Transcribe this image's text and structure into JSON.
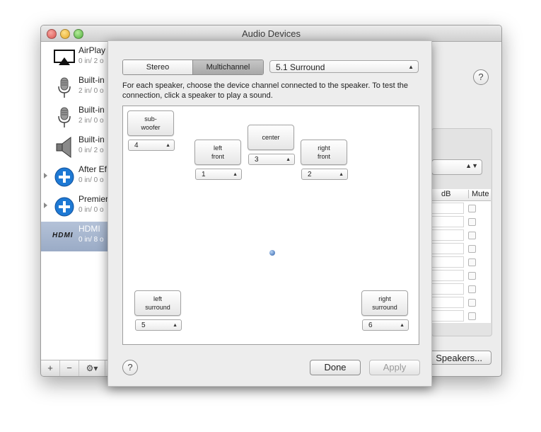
{
  "window": {
    "title": "Audio Devices"
  },
  "sidebar": {
    "devices": [
      {
        "name": "AirPlay",
        "channels": "0 in/ 2 o",
        "icon": "airplay-icon"
      },
      {
        "name": "Built-in",
        "channels": "2 in/ 0 o",
        "icon": "microphone-icon"
      },
      {
        "name": "Built-in",
        "channels": "2 in/ 0 o",
        "icon": "microphone-icon"
      },
      {
        "name": "Built-in",
        "channels": "0 in/ 2 o",
        "icon": "speaker-icon"
      },
      {
        "name": "After Ef",
        "channels": "0 in/ 0 o",
        "icon": "aggregate-plus-icon"
      },
      {
        "name": "Premier",
        "channels": "0 in/ 0 o",
        "icon": "aggregate-plus-icon"
      },
      {
        "name": "HDMI",
        "channels": "0 in/ 8 o",
        "icon": "hdmi-logo",
        "logo_text": "HDMI"
      }
    ],
    "bottom": {
      "add": "+",
      "remove": "−",
      "gear": "⚙▾"
    }
  },
  "main": {
    "help": "?",
    "table": {
      "col_db": "dB",
      "col_mute": "Mute"
    },
    "configure_button": "Speakers..."
  },
  "sheet": {
    "mode_tabs": [
      "Stereo",
      "Multichannel"
    ],
    "selected_mode": "Multichannel",
    "layout_popup": "5.1 Surround",
    "instructions": "For each speaker, choose the device channel connected to the speaker. To test the connection, click a speaker to play a sound.",
    "speakers": {
      "subwoofer": {
        "label": "sub-\nwoofer",
        "channel": "4"
      },
      "left_front": {
        "label": "left\nfront",
        "channel": "1"
      },
      "center": {
        "label": "center",
        "channel": "3"
      },
      "right_front": {
        "label": "right\nfront",
        "channel": "2"
      },
      "left_surround": {
        "label": "left\nsurround",
        "channel": "5"
      },
      "right_surround": {
        "label": "right\nsurround",
        "channel": "6"
      }
    },
    "help": "?",
    "done": "Done",
    "apply": "Apply"
  }
}
